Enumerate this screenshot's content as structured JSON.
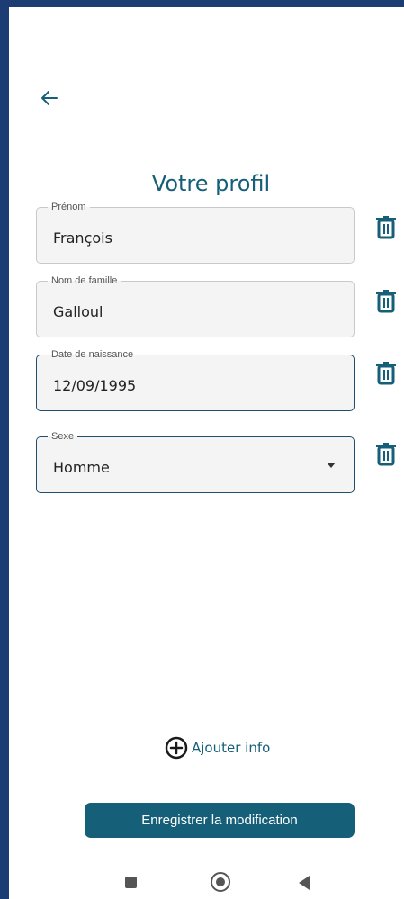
{
  "header": {
    "back_icon": "arrow-left-icon",
    "title": "Votre profil"
  },
  "fields": [
    {
      "label": "Prénom",
      "value": "François"
    },
    {
      "label": "Nom de famille",
      "value": "Galloul"
    },
    {
      "label": "Date de naissance",
      "value": "12/09/1995"
    },
    {
      "label": "Sexe",
      "value": "Homme"
    }
  ],
  "actions": {
    "add_info_label": "Ajouter info",
    "save_label": "Enregistrer la modification"
  },
  "icons": {
    "delete": "trash-icon",
    "add": "plus-circle-icon",
    "dropdown": "caret-down-icon"
  },
  "colors": {
    "primary": "#155f78",
    "frame": "#1c3d73",
    "field_bg": "#f4f4f4",
    "active_border": "#1f4e6e"
  }
}
